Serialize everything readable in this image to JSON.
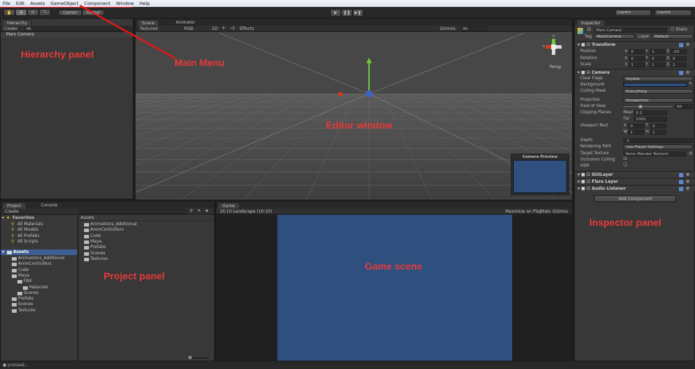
{
  "menu": [
    "File",
    "Edit",
    "Assets",
    "GameObject",
    "Component",
    "Window",
    "Help"
  ],
  "toolbar": {
    "pivot": "Center",
    "space": "Global",
    "layers": "Layers",
    "layout": "Layout",
    "play_icons": [
      "play-icon",
      "pause-icon",
      "step-icon"
    ]
  },
  "hierarchy": {
    "tab": "Hierarchy",
    "create": "Create",
    "search_placeholder": "All",
    "items": [
      "Main Camera"
    ]
  },
  "scene": {
    "tabs": [
      "Scene",
      "Animator"
    ],
    "shading": "Textured",
    "render": "RGB",
    "mode_2d": "2D",
    "effects": "Effects",
    "gizmos": "Gizmos",
    "search_placeholder": "All",
    "persp": "Persp",
    "gizmo_y": "y",
    "gizmo_x": "x",
    "camera_preview": "Camera Preview",
    "sky_color": "#474747",
    "preview_color": "#2f4f7f"
  },
  "inspector": {
    "tab": "Inspector",
    "object_name": "Main Camera",
    "static": "Static",
    "tag_label": "Tag",
    "tag": "MainCamera",
    "layer_label": "Layer",
    "layer": "Default",
    "transform": {
      "title": "Transform",
      "rows": [
        {
          "label": "Position",
          "x": "0",
          "y": "1",
          "z": "-10"
        },
        {
          "label": "Rotation",
          "x": "0",
          "y": "0",
          "z": "0"
        },
        {
          "label": "Scale",
          "x": "1",
          "y": "1",
          "z": "1"
        }
      ]
    },
    "camera": {
      "title": "Camera",
      "clear_flags": {
        "label": "Clear Flags",
        "value": "Skybox"
      },
      "background": {
        "label": "Background",
        "color": "#2f4f7f"
      },
      "culling_mask": {
        "label": "Culling Mask",
        "value": "Everything"
      },
      "projection": {
        "label": "Projection",
        "value": "Perspective"
      },
      "fov": {
        "label": "Field of View",
        "value": "60"
      },
      "clipping": {
        "label": "Clipping Planes",
        "near_label": "Near",
        "near": "0.3",
        "far_label": "Far",
        "far": "1000"
      },
      "viewport": {
        "label": "Viewport Rect",
        "x": "0",
        "y": "0",
        "w": "1",
        "h": "1"
      },
      "depth": {
        "label": "Depth",
        "value": "-1"
      },
      "rendering_path": {
        "label": "Rendering Path",
        "value": "Use Player Settings"
      },
      "target_texture": {
        "label": "Target Texture",
        "value": "None (Render Texture)"
      },
      "occlusion": {
        "label": "Occlusion Culling",
        "checked": true
      },
      "hdr": {
        "label": "HDR",
        "checked": false
      }
    },
    "components": [
      "GUILayer",
      "Flare Layer",
      "Audio Listener"
    ],
    "add_component": "Add Component"
  },
  "project": {
    "tabs": [
      "Project",
      "Console"
    ],
    "create": "Create",
    "favorites_label": "Favorites",
    "favorites": [
      "All Materials",
      "All Models",
      "All Prefabs",
      "All Scripts"
    ],
    "assets_label": "Assets",
    "tree": [
      {
        "name": "Animations_Additional",
        "d": 1
      },
      {
        "name": "AnimControllers",
        "d": 1
      },
      {
        "name": "Code",
        "d": 1
      },
      {
        "name": "Maya",
        "d": 1
      },
      {
        "name": "FBX",
        "d": 2
      },
      {
        "name": "Materials",
        "d": 3
      },
      {
        "name": "Scenes",
        "d": 2
      },
      {
        "name": "Prefabs",
        "d": 1
      },
      {
        "name": "Scenes",
        "d": 1
      },
      {
        "name": "Textures",
        "d": 1
      }
    ],
    "breadcrumb": "Assets",
    "folders": [
      "Animations_Additional",
      "AnimControllers",
      "Code",
      "Maya",
      "Prefabs",
      "Scenes",
      "Textures"
    ]
  },
  "game": {
    "tab": "Game",
    "aspect": "16:10 Landscape (16:10)",
    "maximize": "Maximize on Play",
    "stats": "Stats",
    "gizmos": "Gizmos",
    "view_color": "#2f4f7f"
  },
  "status": {
    "text": "pressed..."
  },
  "annotations": {
    "hierarchy": "Hierarchy panel",
    "menu": "Main Menu",
    "editor": "Editor window",
    "inspector": "Inspector panel",
    "project": "Project panel",
    "game": "Game scene",
    "color": "#e83a3a"
  }
}
